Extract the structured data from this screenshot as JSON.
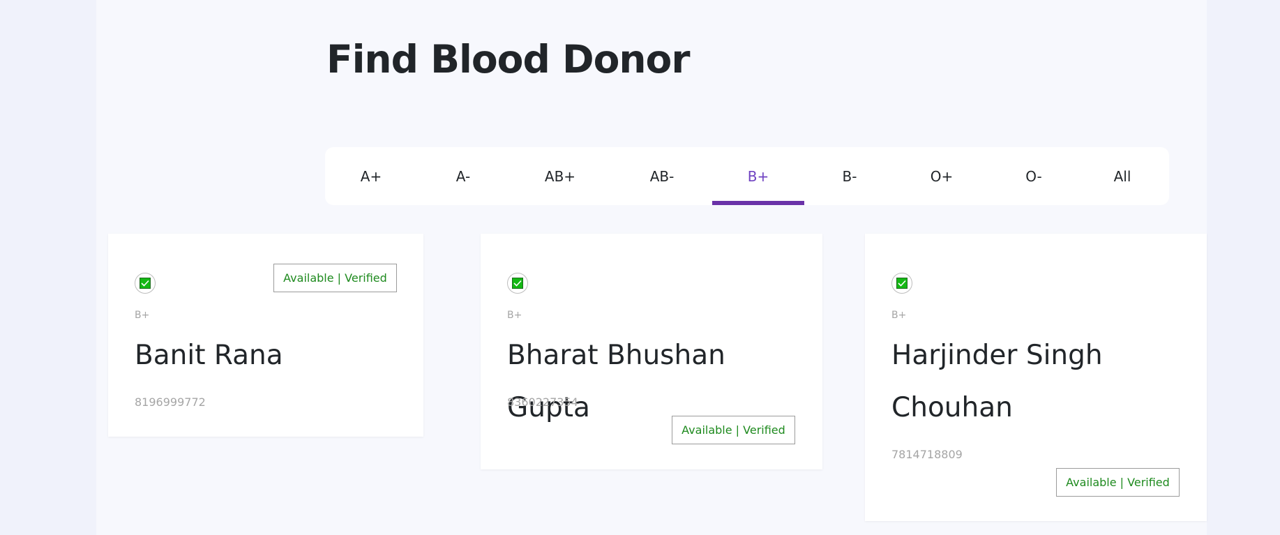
{
  "page": {
    "title": "Find Blood Donor"
  },
  "tabs": [
    {
      "label": "A+",
      "active": false
    },
    {
      "label": "A-",
      "active": false
    },
    {
      "label": "AB+",
      "active": false
    },
    {
      "label": "AB-",
      "active": false
    },
    {
      "label": "B+",
      "active": true
    },
    {
      "label": "B-",
      "active": false
    },
    {
      "label": "O+",
      "active": false
    },
    {
      "label": "O-",
      "active": false
    },
    {
      "label": "All",
      "active": false
    }
  ],
  "donors": [
    {
      "blood_group": "B+",
      "name": "Banit Rana",
      "phone": "8196999772",
      "status": "Available | Verified"
    },
    {
      "blood_group": "B+",
      "name": "Bharat Bhushan Gupta",
      "phone": "8360227354",
      "status": "Available | Verified"
    },
    {
      "blood_group": "B+",
      "name": "Harjinder Singh Chouhan",
      "phone": "7814718809",
      "status": "Available | Verified"
    }
  ],
  "colors": {
    "accent": "#6f42c1",
    "status_text": "#1e8a1e",
    "check_fill": "#14b814"
  },
  "icons": {
    "verified": "check-box-icon"
  }
}
